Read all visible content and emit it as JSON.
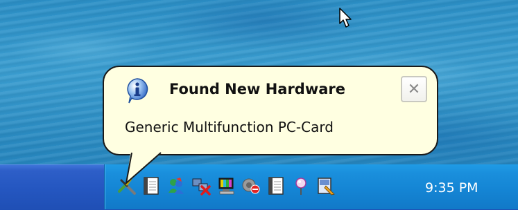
{
  "balloon": {
    "title": "Found New Hardware",
    "message": "Generic Multifunction PC-Card",
    "close_glyph": "✕",
    "background_color": "#ffffe1",
    "icon": "info-icon"
  },
  "taskbar": {
    "clock": "9:35 PM",
    "tray_icons": [
      "hardware-plugin-icon",
      "notepad-icon",
      "windows-messenger-icon",
      "network-disconnected-icon",
      "display-settings-icon",
      "speaker-muted-icon",
      "notepad-icon",
      "pin-icon",
      "document-edit-icon"
    ],
    "taskbar_color": "#2557c1",
    "tray_color": "#1484d3"
  }
}
